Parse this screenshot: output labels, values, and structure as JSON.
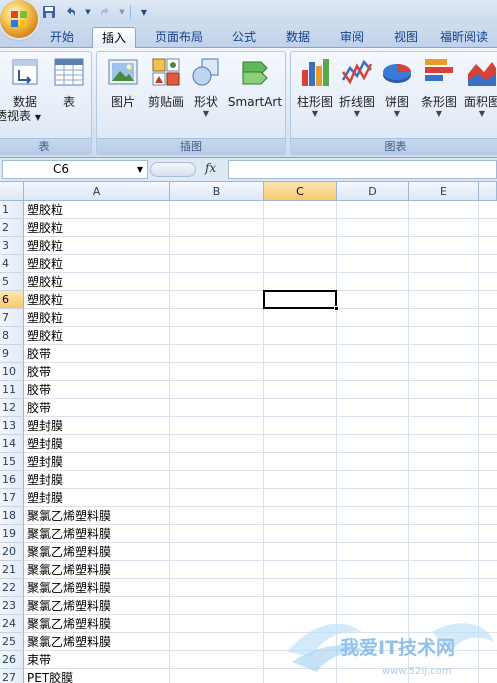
{
  "tabs": [
    {
      "label": "开始"
    },
    {
      "label": "插入"
    },
    {
      "label": "页面布局"
    },
    {
      "label": "公式"
    },
    {
      "label": "数据"
    },
    {
      "label": "审阅"
    },
    {
      "label": "视图"
    },
    {
      "label": "福昕阅读器"
    }
  ],
  "active_tab": "插入",
  "ribbon": {
    "table_group": {
      "label": "表",
      "pivot_label_1": "数据",
      "pivot_label_2": "透视表",
      "table_label": "表"
    },
    "illustration_group": {
      "label": "插图",
      "picture": "图片",
      "clipart": "剪贴画",
      "shapes": "形状",
      "smartart": "SmartArt"
    },
    "chart_group": {
      "label": "图表",
      "column": "柱形图",
      "line": "折线图",
      "pie": "饼图",
      "bar": "条形图",
      "area": "面积图"
    }
  },
  "formula_bar": {
    "name_box": "C6",
    "fx": "fx",
    "formula": ""
  },
  "grid": {
    "columns": [
      "A",
      "B",
      "C",
      "D",
      "E"
    ],
    "selected_column": "C",
    "selected_row": 6,
    "rows": [
      {
        "num": "1",
        "a": "塑胶粒"
      },
      {
        "num": "2",
        "a": "塑胶粒"
      },
      {
        "num": "3",
        "a": "塑胶粒"
      },
      {
        "num": "4",
        "a": "塑胶粒"
      },
      {
        "num": "5",
        "a": "塑胶粒"
      },
      {
        "num": "6",
        "a": "塑胶粒"
      },
      {
        "num": "7",
        "a": "塑胶粒"
      },
      {
        "num": "8",
        "a": "塑胶粒"
      },
      {
        "num": "9",
        "a": "胶带"
      },
      {
        "num": "10",
        "a": "胶带"
      },
      {
        "num": "11",
        "a": "胶带"
      },
      {
        "num": "12",
        "a": "胶带"
      },
      {
        "num": "13",
        "a": "塑封膜"
      },
      {
        "num": "14",
        "a": "塑封膜"
      },
      {
        "num": "15",
        "a": "塑封膜"
      },
      {
        "num": "16",
        "a": "塑封膜"
      },
      {
        "num": "17",
        "a": "塑封膜"
      },
      {
        "num": "18",
        "a": "聚氯乙烯塑料膜"
      },
      {
        "num": "19",
        "a": "聚氯乙烯塑料膜"
      },
      {
        "num": "20",
        "a": "聚氯乙烯塑料膜"
      },
      {
        "num": "21",
        "a": "聚氯乙烯塑料膜"
      },
      {
        "num": "22",
        "a": "聚氯乙烯塑料膜"
      },
      {
        "num": "23",
        "a": "聚氯乙烯塑料膜"
      },
      {
        "num": "24",
        "a": "聚氯乙烯塑料膜"
      },
      {
        "num": "25",
        "a": "聚氯乙烯塑料膜"
      },
      {
        "num": "26",
        "a": "束带"
      },
      {
        "num": "27",
        "a": "PET胶膜"
      }
    ]
  },
  "watermark": {
    "text": "我爱IT技术网",
    "url": "www.52ij.com"
  },
  "colors": {
    "tab_text": "#15428b",
    "selected_header": "#f8c86c",
    "ribbon_bg": "#dde8f6"
  }
}
